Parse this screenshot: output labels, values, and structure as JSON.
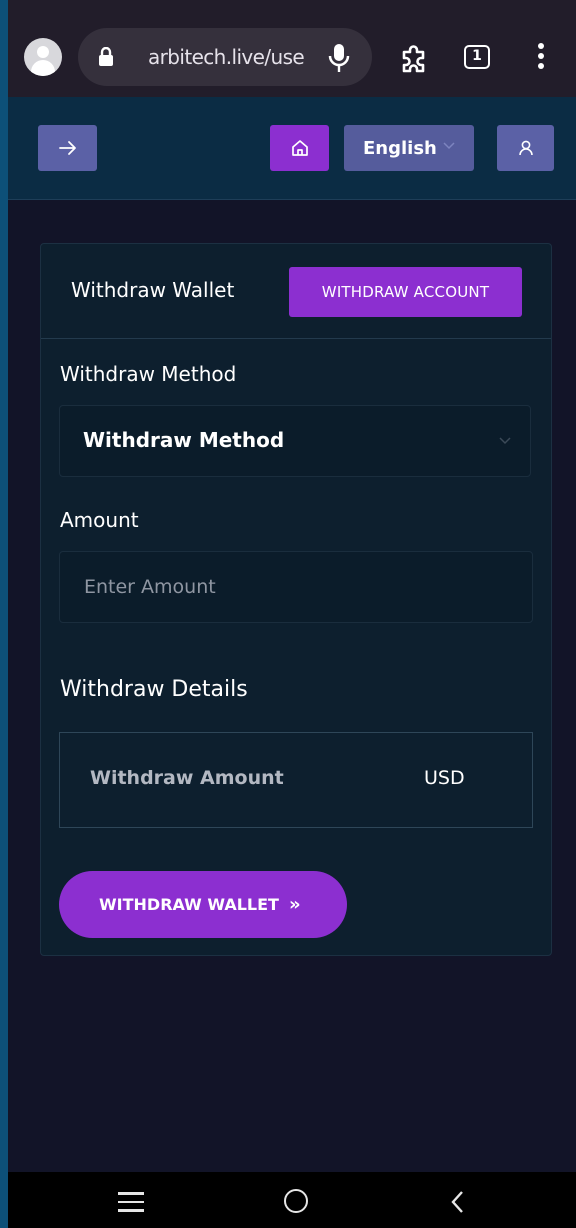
{
  "browser": {
    "url": "arbitech.live/user",
    "tab_count": "1",
    "icons": [
      "account-avatar-icon",
      "lock-icon",
      "mic-icon",
      "extensions-icon",
      "tab-switcher-icon",
      "more-vert-icon"
    ]
  },
  "header": {
    "language": "English",
    "icons": [
      "arrow-right-icon",
      "home-icon",
      "chevron-down-icon",
      "user-icon"
    ]
  },
  "card": {
    "title": "Withdraw Wallet",
    "account_button": "WITHDRAW ACCOUNT",
    "method_label": "Withdraw Method",
    "method_select_value": "Withdraw Method",
    "amount_label": "Amount",
    "amount_placeholder": "Enter Amount",
    "amount_value": "",
    "details_title": "Withdraw Details",
    "details": {
      "key": "Withdraw Amount",
      "value": "USD"
    },
    "submit_button": "WITHDRAW WALLET",
    "submit_icon": "»"
  },
  "colors": {
    "accent": "#8c2fd0",
    "header_button": "#5b61a6",
    "card_bg": "#0d1f2e",
    "page_bg": "#121428"
  }
}
